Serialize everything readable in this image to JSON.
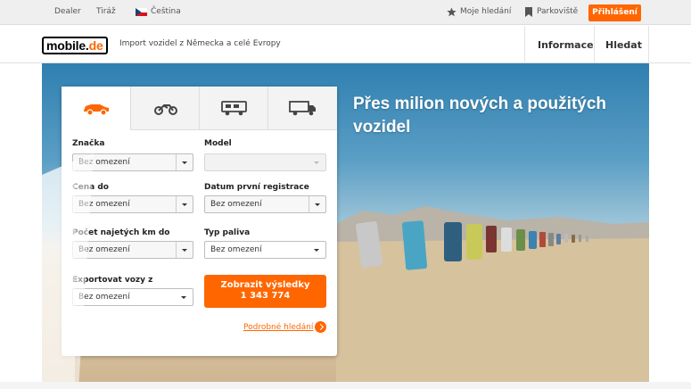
{
  "topbar": {
    "dealer": "Dealer",
    "tiraz": "Tiráž",
    "language": "Čeština",
    "saved_searches": "Moje hledání",
    "parking": "Parkoviště",
    "login": "Přihlášení"
  },
  "header": {
    "logo_main": "mobile",
    "logo_dot": ".",
    "logo_de": "de",
    "tagline": "Import vozidel z Německa a celé Evropy",
    "nav": [
      "Informace",
      "Hledat"
    ]
  },
  "hero": {
    "title": "Přes milion nových a použitých vozidel"
  },
  "search": {
    "tabs": [
      "car-icon",
      "motorbike-icon",
      "motorhome-icon",
      "truck-icon"
    ],
    "make_label": "Značka",
    "make_value": "Bez omezení",
    "model_label": "Model",
    "model_value": "",
    "price_label": "Cena do",
    "price_value": "Bez omezení",
    "registration_label": "Datum první registrace",
    "registration_value": "Bez omezení",
    "mileage_label": "Počet najetých km do",
    "mileage_value": "Bez omezení",
    "fuel_label": "Typ paliva",
    "fuel_value": "Bez omezení",
    "export_label": "Exportovat vozy z",
    "export_value": "Bez omezení",
    "show_results_line1": "Zobrazit výsledky",
    "show_results_count": "1 343 774",
    "detailed_search": "Podrobné hledání"
  },
  "colors": {
    "accent": "#ff6600"
  }
}
